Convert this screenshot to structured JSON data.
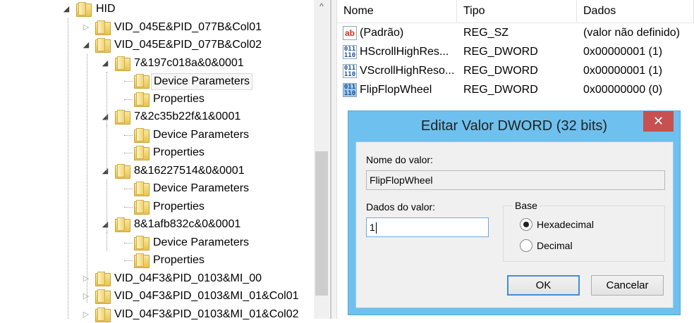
{
  "tree": [
    {
      "label": "HID",
      "level": 0,
      "state": "open"
    },
    {
      "label": "VID_045E&PID_077B&Col01",
      "level": 1,
      "state": "closed"
    },
    {
      "label": "VID_045E&PID_077B&Col02",
      "level": 1,
      "state": "open"
    },
    {
      "label": "7&197c018a&0&0001",
      "level": 2,
      "state": "open"
    },
    {
      "label": "Device Parameters",
      "level": 3,
      "state": "none",
      "selected": true
    },
    {
      "label": "Properties",
      "level": 3,
      "state": "none"
    },
    {
      "label": "7&2c35b22f&1&0001",
      "level": 2,
      "state": "open"
    },
    {
      "label": "Device Parameters",
      "level": 3,
      "state": "none"
    },
    {
      "label": "Properties",
      "level": 3,
      "state": "none"
    },
    {
      "label": "8&16227514&0&0001",
      "level": 2,
      "state": "open"
    },
    {
      "label": "Device Parameters",
      "level": 3,
      "state": "none"
    },
    {
      "label": "Properties",
      "level": 3,
      "state": "none"
    },
    {
      "label": "8&1afb832c&0&0001",
      "level": 2,
      "state": "open"
    },
    {
      "label": "Device Parameters",
      "level": 3,
      "state": "none"
    },
    {
      "label": "Properties",
      "level": 3,
      "state": "none"
    },
    {
      "label": "VID_04F3&PID_0103&MI_00",
      "level": 1,
      "state": "closed"
    },
    {
      "label": "VID_04F3&PID_0103&MI_01&Col01",
      "level": 1,
      "state": "closed"
    },
    {
      "label": "VID_04F3&PID_0103&MI_01&Col02",
      "level": 1,
      "state": "closed"
    }
  ],
  "list": {
    "columns": [
      "Nome",
      "Tipo",
      "Dados"
    ],
    "rows": [
      {
        "icon": "string-value-icon",
        "glyph": "ab",
        "name": "(Padrão)",
        "type": "REG_SZ",
        "data": "(valor não definido)"
      },
      {
        "icon": "binary-value-icon",
        "glyph": "011 110",
        "name": "HScrollHighRes...",
        "type": "REG_DWORD",
        "data": "0x00000001 (1)"
      },
      {
        "icon": "binary-value-icon",
        "glyph": "011 110",
        "name": "VScrollHighReso...",
        "type": "REG_DWORD",
        "data": "0x00000001 (1)"
      },
      {
        "icon": "binary-value-icon",
        "glyph": "011 110",
        "name": "FlipFlopWheel",
        "type": "REG_DWORD",
        "data": "0x00000000 (0)",
        "selected": true
      }
    ]
  },
  "dialog": {
    "title": "Editar Valor DWORD (32 bits)",
    "close": "✕",
    "name_label": "Nome do valor:",
    "name_value": "FlipFlopWheel",
    "data_label": "Dados do valor:",
    "data_value": "1",
    "base_label": "Base",
    "hex_label": "Hexadecimal",
    "dec_label": "Decimal",
    "selected_base": "hex",
    "ok": "OK",
    "cancel": "Cancelar"
  },
  "scroll_up": "^"
}
